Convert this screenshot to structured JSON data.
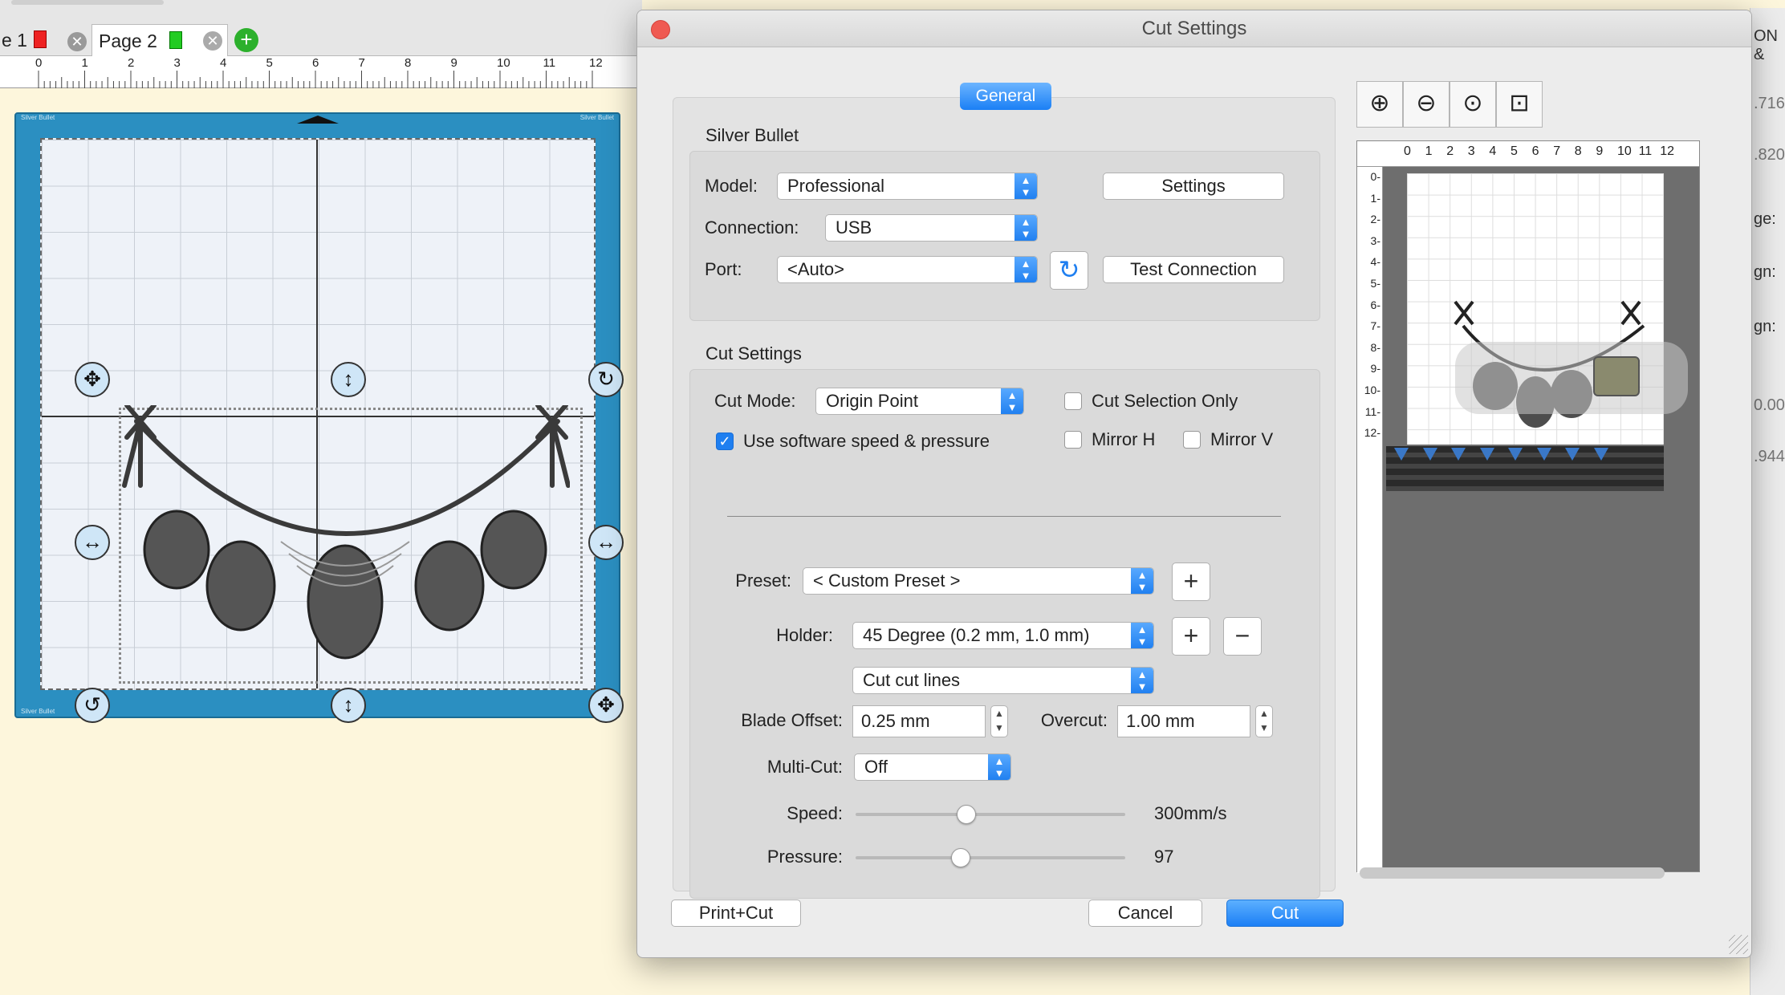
{
  "background": {
    "tabs": {
      "page1_label": "e 1",
      "page2_label": "Page 2"
    },
    "ruler_ticks": [
      "0",
      "1",
      "2",
      "3",
      "4",
      "5",
      "6",
      "7",
      "8",
      "9",
      "10",
      "11",
      "12"
    ],
    "mat_brand": "Silver Bullet",
    "right_fragments": [
      "ON &",
      ".716",
      ".820",
      "ge:",
      "gn:",
      "gn:",
      "0.00",
      ".944"
    ]
  },
  "dialog": {
    "title": "Cut Settings",
    "tab_general": "General",
    "machine_section": {
      "heading": "Silver Bullet",
      "model_label": "Model:",
      "model_value": "Professional",
      "connection_label": "Connection:",
      "connection_value": "USB",
      "port_label": "Port:",
      "port_value": "<Auto>",
      "settings_button": "Settings",
      "test_connection_button": "Test Connection"
    },
    "cut_section": {
      "heading": "Cut Settings",
      "cut_mode_label": "Cut Mode:",
      "cut_mode_value": "Origin Point",
      "cut_selection_only_label": "Cut Selection Only",
      "cut_selection_only_checked": false,
      "use_software_label": "Use software speed & pressure",
      "use_software_checked": true,
      "mirror_h_label": "Mirror H",
      "mirror_v_label": "Mirror V",
      "preset_label": "Preset:",
      "preset_value": "< Custom Preset >",
      "holder_label": "Holder:",
      "holder_value": "45 Degree (0.2 mm, 1.0 mm)",
      "line_mode_value": "Cut cut lines",
      "blade_offset_label": "Blade Offset:",
      "blade_offset_value": "0.25 mm",
      "overcut_label": "Overcut:",
      "overcut_value": "1.00 mm",
      "multicut_label": "Multi-Cut:",
      "multicut_value": "Off",
      "speed_label": "Speed:",
      "speed_value": "300mm/s",
      "speed_fraction": 0.41,
      "pressure_label": "Pressure:",
      "pressure_value": "97",
      "pressure_fraction": 0.39
    },
    "buttons": {
      "print_cut": "Print+Cut",
      "cancel": "Cancel",
      "cut": "Cut"
    },
    "preview": {
      "ruler_top": [
        "0",
        "1",
        "2",
        "3",
        "4",
        "5",
        "6",
        "7",
        "8",
        "9",
        "10",
        "11",
        "12"
      ],
      "ruler_left": [
        "0-",
        "1-",
        "2-",
        "3-",
        "4-",
        "5-",
        "6-",
        "7-",
        "8-",
        "9-",
        "10-",
        "11-",
        "12-"
      ]
    },
    "colors": {
      "accent": "#1f7ff0",
      "mat": "#2b8fc1",
      "close": "#ef5a52"
    }
  }
}
